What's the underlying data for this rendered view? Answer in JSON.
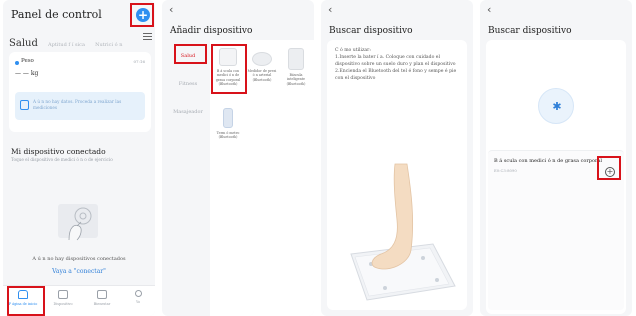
{
  "screen1": {
    "title": "Panel de control",
    "tabs": [
      "Salud",
      "Aptitud f í sica",
      "Nutrici ó n"
    ],
    "weight": {
      "label": "Peso",
      "time": "07:16",
      "value": "— — kg"
    },
    "no_data_text": "A ú n no hay datos. Proceda a realizar las mediciones",
    "my_devices_title": "Mi dispositivo conectado",
    "my_devices_subtitle": "Toque el dispositivo de medici ó n o de ejercicio",
    "no_devices_text": "A ú n no hay dispositivos conectados",
    "connect_link": "Vaya a \"conectar\"",
    "nav": [
      "P ágina de inicio",
      "Dispositivo",
      "Bienestar",
      "Yo"
    ]
  },
  "screen2": {
    "title": "Añadir dispositivo",
    "categories": [
      "Salud",
      "Fitness",
      "Masajeador"
    ],
    "devices": [
      "B á scula con medici ó n de grasa corporal (Bluetooth)",
      "Medidor de presi ó n arterial (Bluetooth)",
      "Báscula inteligente (Bluetooth)",
      "Term ó metro (Bluetooth)"
    ]
  },
  "screen3": {
    "title": "Buscar dispositivo",
    "instructions": [
      "C ó mo utilizar:",
      "1.Inserte la bater í a. Coloque con cuidado el dispositivo sobre un suelo duro y plan el dispositivo",
      "2.Encienda el Bluetooth del tel é fono y sempe é pie con el dispositivo"
    ]
  },
  "screen4": {
    "title": "Buscar dispositivo",
    "found_device": {
      "name": "B á scula con medici ó n de grasa corporal",
      "id": "E0:C3:8090"
    }
  },
  "icons": {
    "back": "chevron-left-icon",
    "add": "plus-icon",
    "bluetooth": "bluetooth-icon",
    "menu": "menu-icon"
  },
  "colors": {
    "accent": "#2f8ff0",
    "highlight": "#d8121a",
    "panel_bg": "#f5f6f8"
  }
}
